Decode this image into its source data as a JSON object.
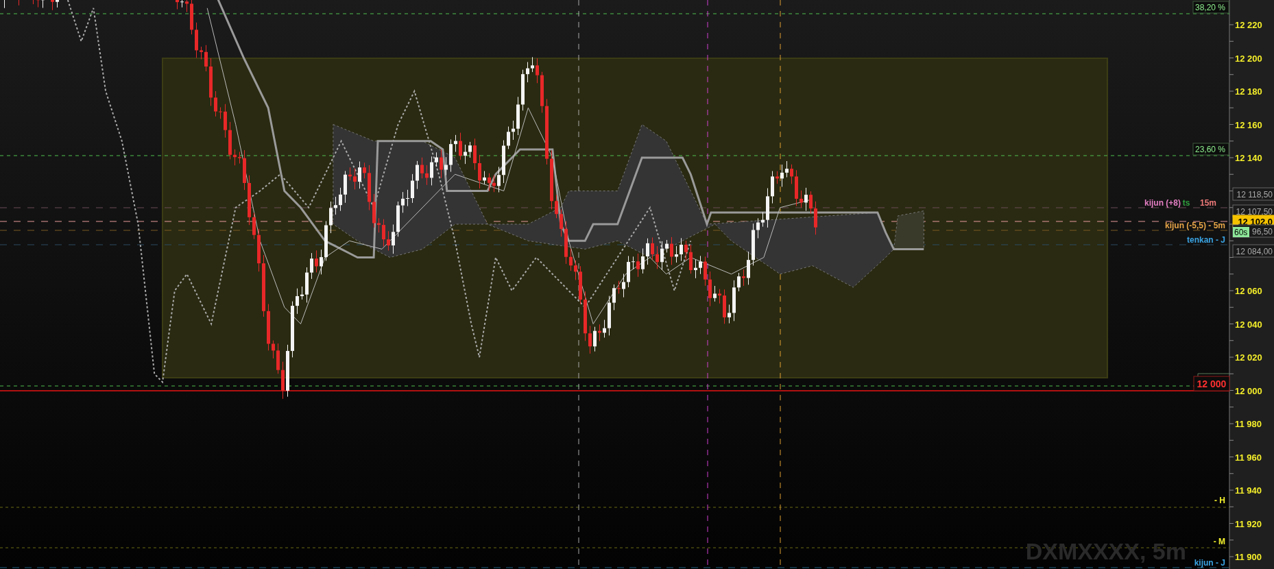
{
  "chart": {
    "symbol": "DXMXXXX, 5m",
    "price_axis": [
      {
        "label": "12 220"
      },
      {
        "label": "12 200"
      },
      {
        "label": "12 180"
      },
      {
        "label": "12 160"
      },
      {
        "label": "12 140"
      },
      {
        "label": "12 060"
      },
      {
        "label": "12 040"
      },
      {
        "label": "12 020"
      },
      {
        "label": "12 000"
      },
      {
        "label": "11 980"
      },
      {
        "label": "11 960"
      },
      {
        "label": "11 940"
      },
      {
        "label": "11 920"
      },
      {
        "label": "11 900"
      }
    ],
    "fib_levels": [
      {
        "label": "38,20 %"
      },
      {
        "label": "23,60 %"
      }
    ],
    "price_tags": [
      {
        "text": "12 118,50",
        "kind": "plain"
      },
      {
        "text": "12 107,50",
        "kind": "plain"
      },
      {
        "text": "12 102,0",
        "kind": "last"
      },
      {
        "text": "96,50",
        "kind": "plain"
      },
      {
        "text": "12 084,00",
        "kind": "plain"
      }
    ],
    "countdown": "60s",
    "alert": "12 000",
    "line_labels": [
      {
        "text": "kijun (+8)",
        "color": "#e57fc4"
      },
      {
        "text": "ts",
        "color": "#2f9e3e"
      },
      {
        "text": "15m",
        "color": "#f07a7a"
      },
      {
        "text": "kijun (-5,5) - 5m",
        "color": "#e8a648"
      },
      {
        "text": "tenkan - J",
        "color": "#3aa4e4"
      },
      {
        "text": "- H",
        "color": "#f2f02c"
      },
      {
        "text": "- M",
        "color": "#f2f02c"
      },
      {
        "text": "kijun - J",
        "color": "#3aa4e4"
      }
    ]
  }
}
